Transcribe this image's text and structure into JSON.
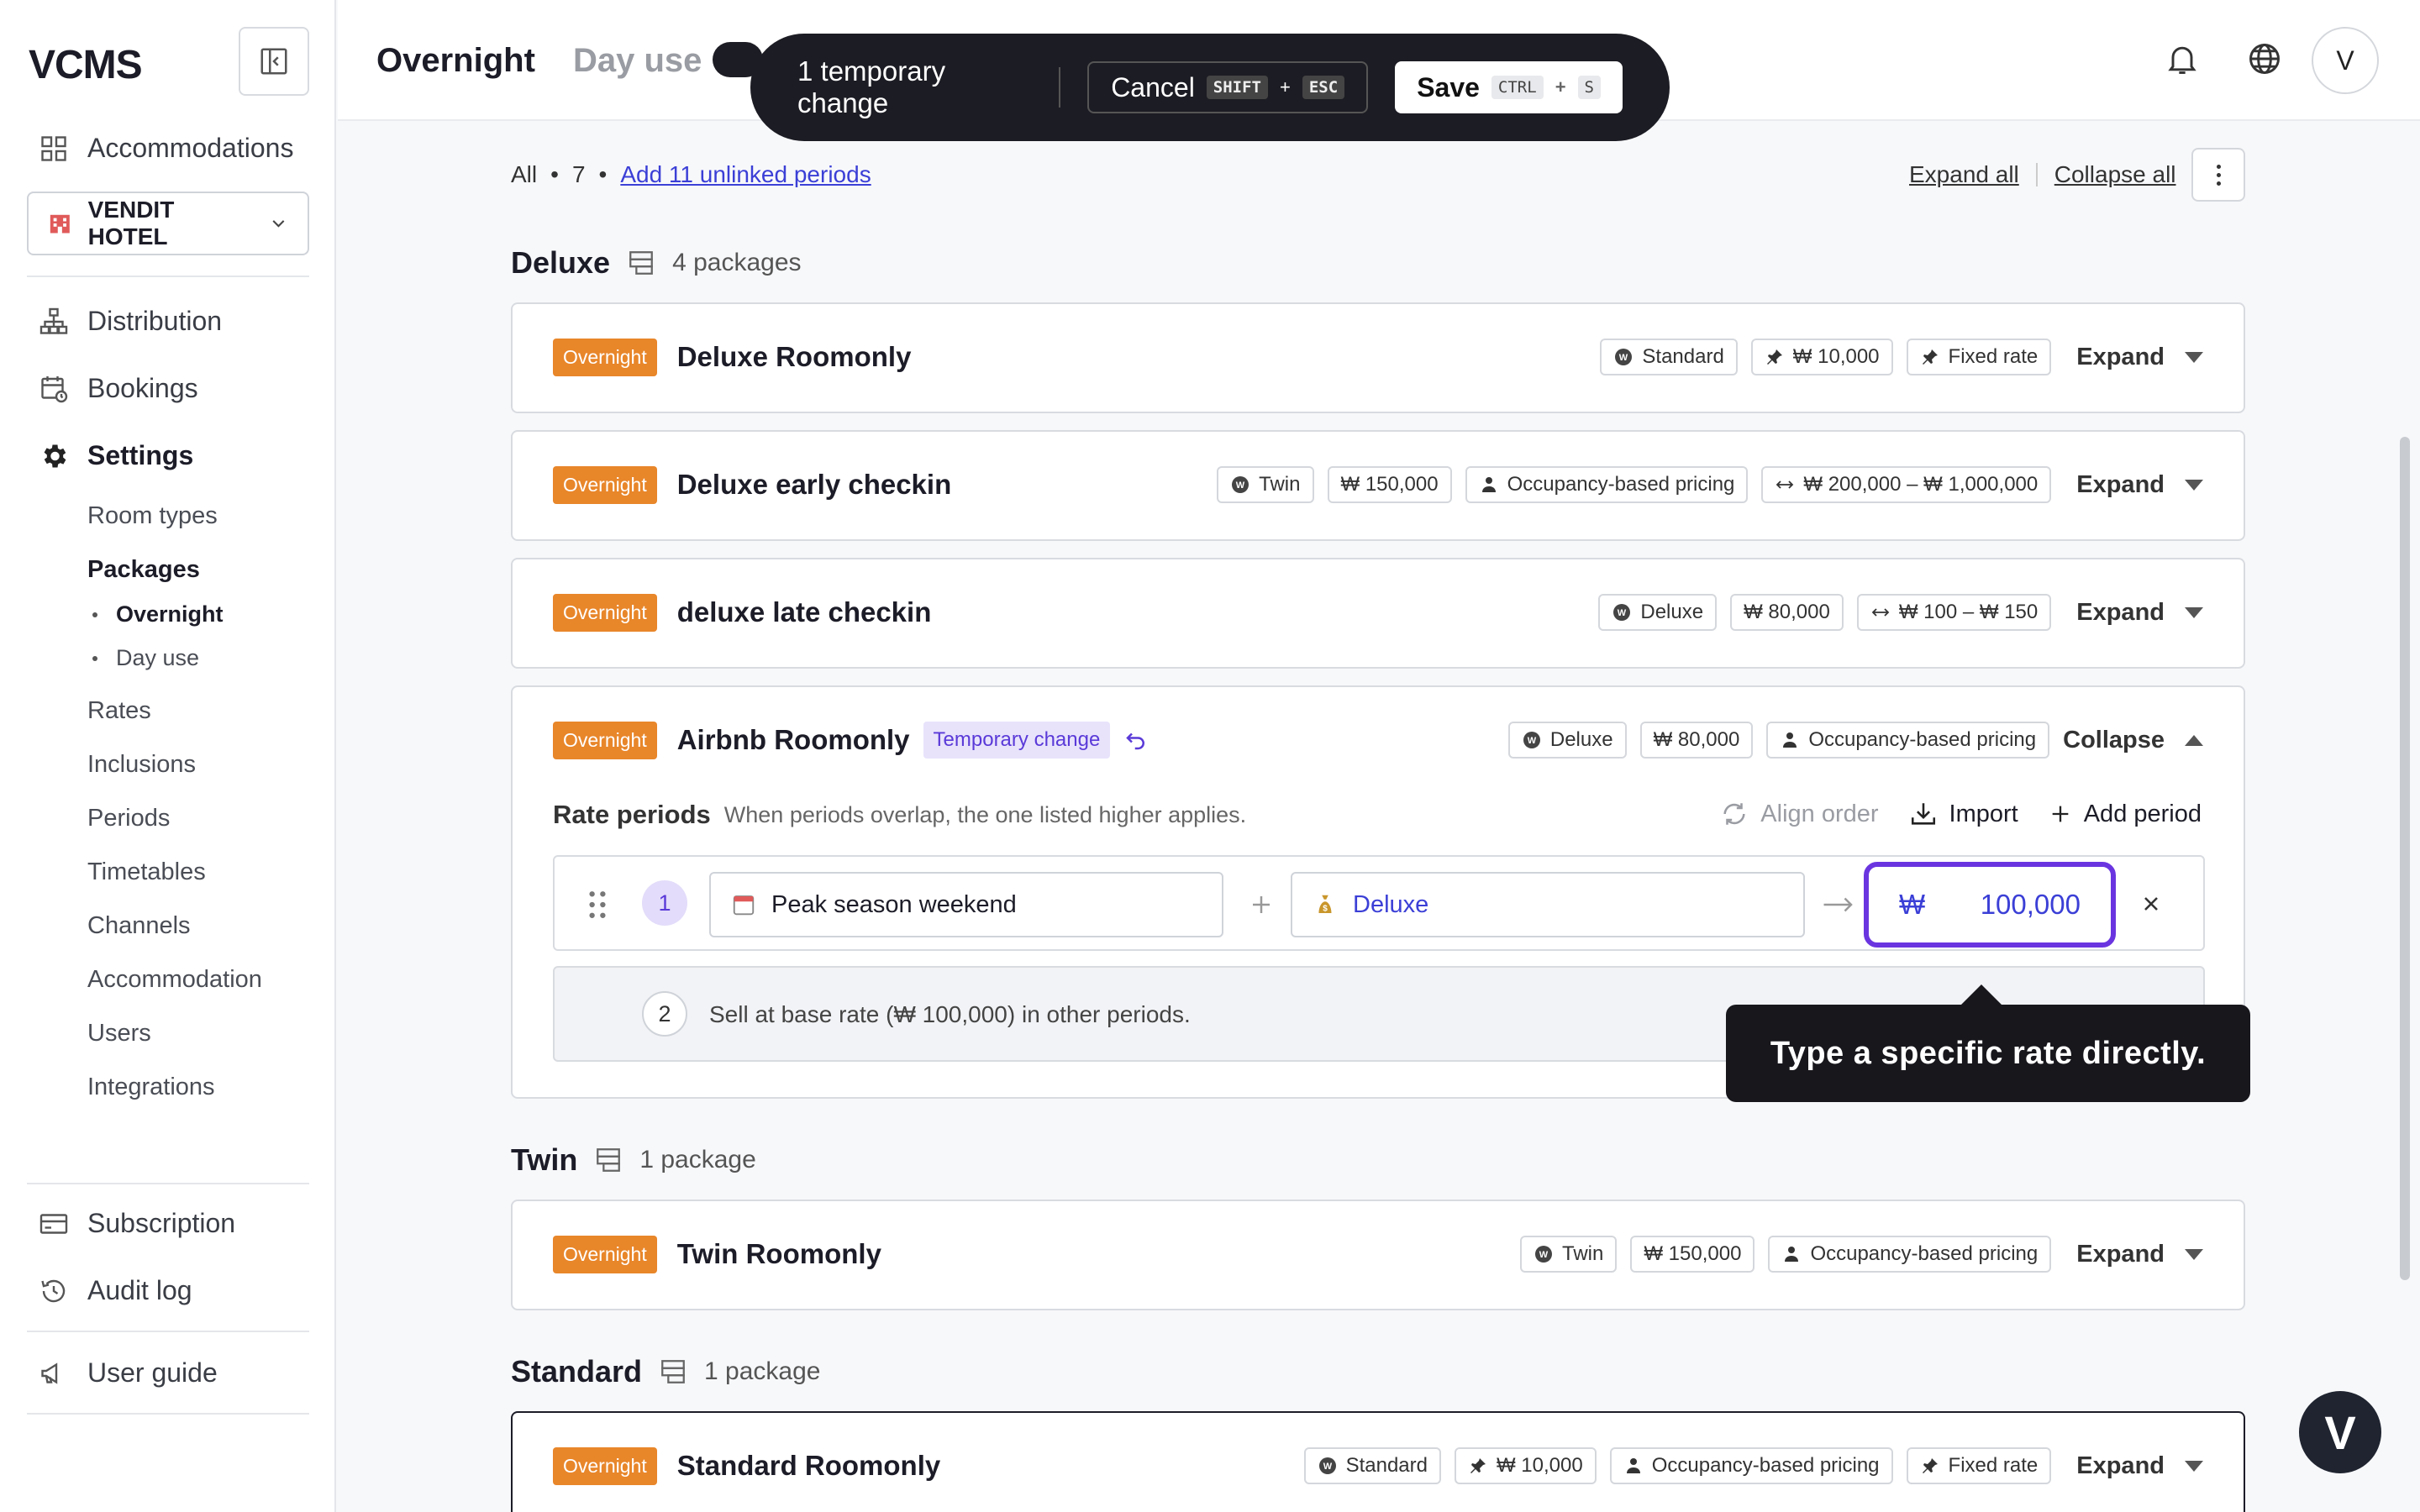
{
  "app": {
    "logo": "VCMS"
  },
  "sidebar": {
    "accommodations": "Accommodations",
    "hotel": "VENDIT HOTEL",
    "distribution": "Distribution",
    "bookings": "Bookings",
    "settings": "Settings",
    "settings_items": [
      "Room types",
      "Packages",
      "Rates",
      "Inclusions",
      "Periods",
      "Timetables",
      "Channels",
      "Accommodation",
      "Users",
      "Integrations"
    ],
    "package_items": [
      "Overnight",
      "Day use"
    ],
    "subscription": "Subscription",
    "audit_log": "Audit log",
    "user_guide": "User guide"
  },
  "header": {
    "tab_overnight": "Overnight",
    "tab_dayuse": "Day use",
    "avatar": "V"
  },
  "toast": {
    "message": "1 temporary change",
    "cancel": "Cancel",
    "cancel_k1": "SHIFT",
    "cancel_k2": "ESC",
    "save": "Save",
    "save_k1": "CTRL",
    "save_k2": "S",
    "plus": "+"
  },
  "filter": {
    "all": "All",
    "count": "7",
    "add_link": "Add 11 unlinked periods",
    "expand_all": "Expand all",
    "collapse_all": "Collapse all"
  },
  "sections": [
    {
      "name": "Deluxe",
      "count": "4 packages"
    },
    {
      "name": "Twin",
      "count": "1 package"
    },
    {
      "name": "Standard",
      "count": "1 package"
    }
  ],
  "badge": "Overnight",
  "expand": "Expand",
  "collapse": "Collapse",
  "packages": [
    {
      "name": "Deluxe Roomonly",
      "tags": [
        "Standard",
        "₩ 10,000",
        "Fixed rate"
      ]
    },
    {
      "name": "Deluxe early checkin",
      "tags": [
        "Twin",
        "₩ 150,000",
        "Occupancy-based pricing",
        "₩ 200,000 – ₩ 1,000,000"
      ]
    },
    {
      "name": "deluxe late checkin",
      "tags": [
        "Deluxe",
        "₩ 80,000",
        "₩ 100 – ₩ 150"
      ]
    },
    {
      "name": "Airbnb Roomonly",
      "temp": "Temporary change",
      "tags": [
        "Deluxe",
        "₩ 80,000",
        "Occupancy-based pricing"
      ]
    },
    {
      "name": "Twin Roomonly",
      "tags": [
        "Twin",
        "₩ 150,000",
        "Occupancy-based pricing"
      ]
    },
    {
      "name": "Standard Roomonly",
      "tags": [
        "Standard",
        "₩ 10,000",
        "Occupancy-based pricing",
        "Fixed rate"
      ]
    }
  ],
  "rate_periods": {
    "title": "Rate periods",
    "desc": "When periods overlap, the one listed higher applies.",
    "align": "Align order",
    "import": "Import",
    "add": "Add period",
    "row1_num": "1",
    "row1_period": "Peak season weekend",
    "row1_rate_plan": "Deluxe",
    "row1_currency": "₩",
    "row1_value": "100,000",
    "row2_num": "2",
    "row2_text": "Sell at base rate (₩ 100,000) in other periods."
  },
  "tooltip": "Type a specific rate directly.",
  "fab": "V"
}
